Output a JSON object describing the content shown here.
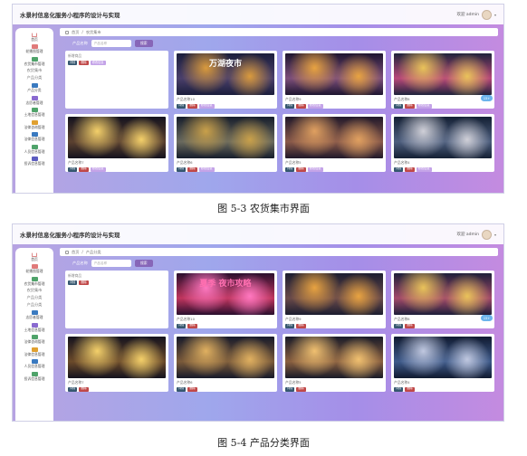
{
  "figures": [
    {
      "app_title": "水景村信息化服务小程序的设计与实现",
      "user_label": "欢迎 admin",
      "breadcrumb": [
        "首页",
        "农货集市"
      ],
      "sidebar": [
        {
          "label": "首页",
          "icon": "home-icon",
          "type": "icon"
        },
        {
          "label": "轮播图管理",
          "icon": "image-icon",
          "type": "icon"
        },
        {
          "label": "农货集市管理",
          "icon": "shop-icon",
          "type": "icon"
        },
        {
          "label": "农货集市",
          "type": "text"
        },
        {
          "label": "产品分类",
          "type": "text"
        },
        {
          "label": "产品分类",
          "icon": "category-icon",
          "type": "icon"
        },
        {
          "label": "志愿者管理",
          "icon": "volunteer-icon",
          "type": "icon"
        },
        {
          "label": "土地信息管理",
          "icon": "land-icon",
          "type": "icon"
        },
        {
          "label": "法律咨询管理",
          "icon": "law-icon",
          "type": "icon"
        },
        {
          "label": "法律信息管理",
          "icon": "law-info-icon",
          "type": "icon"
        },
        {
          "label": "人员信息管理",
          "icon": "people-icon",
          "type": "icon"
        },
        {
          "label": "投诉信息管理",
          "icon": "complaint-icon",
          "type": "icon"
        }
      ],
      "search": {
        "label": "产品名称",
        "placeholder": "产品名称",
        "button": "搜索"
      },
      "add_card_label": "新增商品",
      "buttons": {
        "detail": "详情",
        "delete": "删除",
        "edit": "修改信息"
      },
      "products": [
        {
          "name": "产品名称10",
          "sign": "万湖夜市",
          "colors": [
            "#1b1e3c",
            "#4a3f6b",
            "#d99a3d"
          ]
        },
        {
          "name": "产品名称9",
          "sign": "",
          "colors": [
            "#1e1530",
            "#7d4f7b",
            "#e8a341"
          ]
        },
        {
          "name": "产品名称8",
          "sign": "",
          "colors": [
            "#20243c",
            "#b8477a",
            "#e9c35a"
          ]
        },
        {
          "name": "产品名称7",
          "sign": "",
          "colors": [
            "#14121e",
            "#5b4130",
            "#f4d06a"
          ]
        },
        {
          "name": "产品名称6",
          "sign": "",
          "colors": [
            "#161d2b",
            "#6a6a5e",
            "#c9a04a"
          ]
        },
        {
          "name": "产品名称5",
          "sign": "",
          "colors": [
            "#20182a",
            "#8a5a4a",
            "#e0a060"
          ]
        },
        {
          "name": "产品名称4",
          "sign": "",
          "colors": [
            "#142034",
            "#4d5e7e",
            "#d0d0d8"
          ]
        }
      ],
      "bubble": "15+",
      "caption": "图 5-3 农货集市界面"
    },
    {
      "app_title": "水景村信息化服务小程序的设计与实现",
      "user_label": "欢迎 admin",
      "breadcrumb": [
        "首页",
        "产品分类"
      ],
      "sidebar": [
        {
          "label": "首页",
          "icon": "home-icon",
          "type": "icon"
        },
        {
          "label": "轮播图管理",
          "icon": "image-icon",
          "type": "icon"
        },
        {
          "label": "农货集市管理",
          "icon": "shop-icon",
          "type": "icon"
        },
        {
          "label": "农货集市",
          "type": "text"
        },
        {
          "label": "产品分类",
          "type": "text"
        },
        {
          "label": "产品分类",
          "type": "text"
        },
        {
          "label": "志愿者管理",
          "icon": "volunteer-icon",
          "type": "icon"
        },
        {
          "label": "土地信息管理",
          "icon": "land-icon",
          "type": "icon"
        },
        {
          "label": "法律咨询管理",
          "icon": "law-icon",
          "type": "icon"
        },
        {
          "label": "法律信息管理",
          "icon": "law-info-icon",
          "type": "icon"
        },
        {
          "label": "人员信息管理",
          "icon": "people-icon",
          "type": "icon"
        },
        {
          "label": "投诉信息管理",
          "icon": "complaint-icon",
          "type": "icon"
        }
      ],
      "search": {
        "label": "产品名称",
        "placeholder": "产品名称",
        "button": "搜索"
      },
      "add_card_label": "新增商品",
      "buttons": {
        "detail": "详情",
        "delete": "删除"
      },
      "products": [
        {
          "name": "产品名称10",
          "sign": "夏季 夜市攻略",
          "colors": [
            "#2a0f2e",
            "#c0355e",
            "#ff78c0"
          ]
        },
        {
          "name": "产品名称9",
          "sign": "",
          "colors": [
            "#1c1d30",
            "#6a4a4a",
            "#e8a341"
          ]
        },
        {
          "name": "产品名称8",
          "sign": "",
          "colors": [
            "#1e1f3a",
            "#a34a6a",
            "#e9c35a"
          ]
        },
        {
          "name": "产品名称7",
          "sign": "",
          "colors": [
            "#14121e",
            "#6b4a2a",
            "#f4d06a"
          ]
        },
        {
          "name": "产品名称6",
          "sign": "",
          "colors": [
            "#16192a",
            "#7a5a3a",
            "#e0b060"
          ]
        },
        {
          "name": "产品名称5",
          "sign": "",
          "colors": [
            "#181a28",
            "#8a6040",
            "#f0c070"
          ]
        },
        {
          "name": "产品名称4",
          "sign": "",
          "colors": [
            "#101a30",
            "#3e5a8a",
            "#c0c8e0"
          ]
        }
      ],
      "bubble": "15+",
      "caption": "图 5-4 产品分类界面"
    }
  ]
}
